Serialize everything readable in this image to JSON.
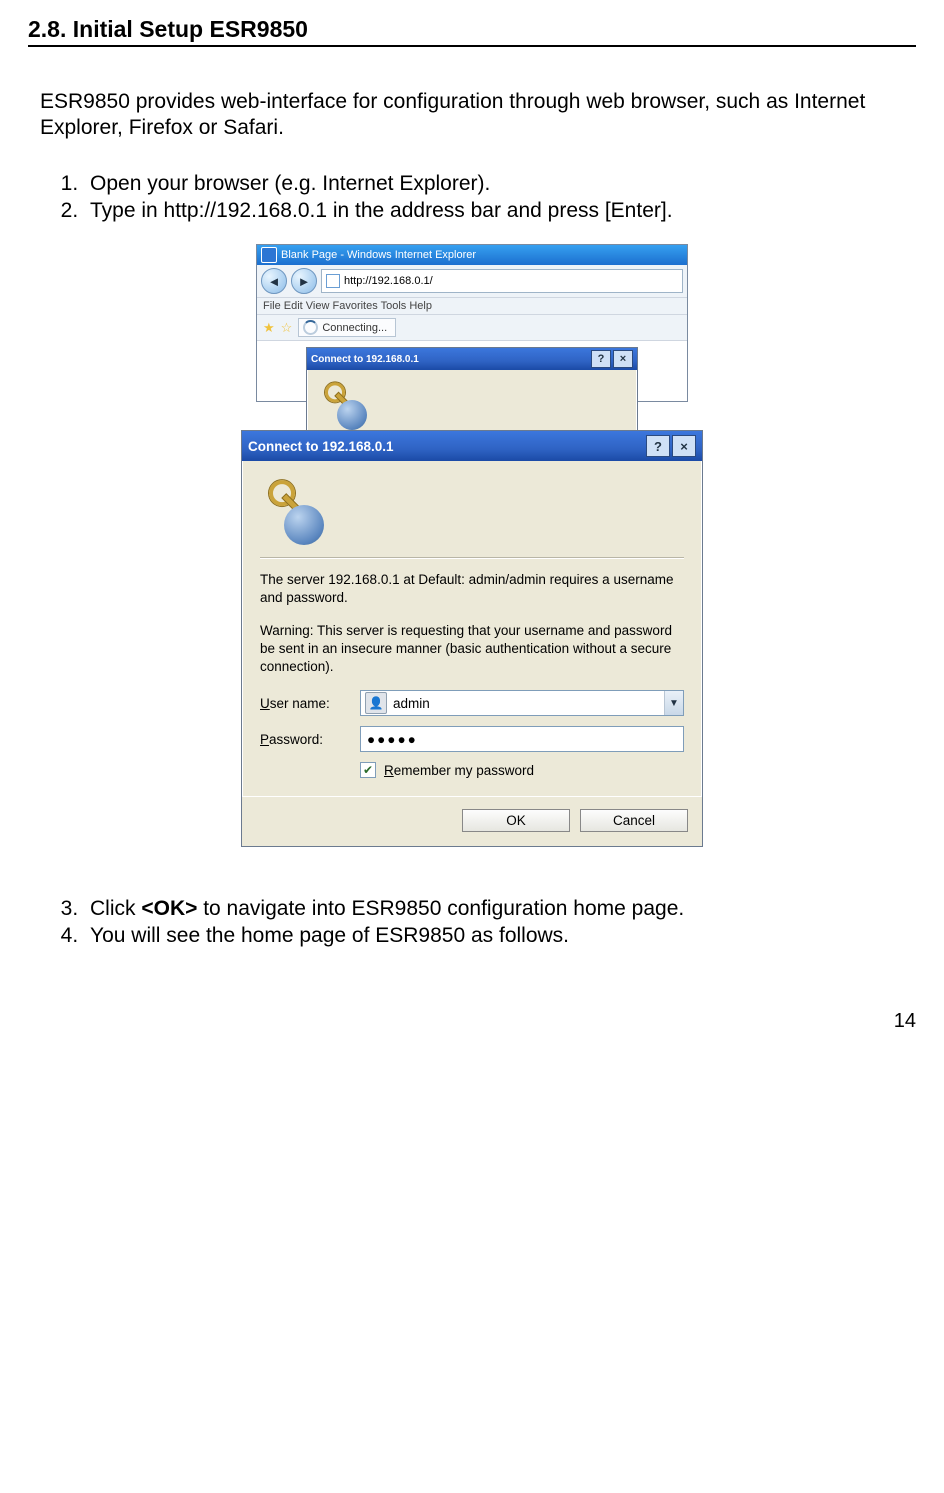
{
  "section_title": "2.8. Initial Setup ESR9850",
  "intro": "ESR9850 provides web-interface for configuration through web browser, such as Internet Explorer, Firefox or Safari.",
  "steps_a": [
    "Open your browser (e.g. Internet Explorer).",
    "Type in http://192.168.0.1 in the address bar and press [Enter]."
  ],
  "ie": {
    "title": "Blank Page - Windows Internet Explorer",
    "address": "http://192.168.0.1/",
    "menu": "File    Edit    View    Favorites    Tools    Help",
    "tab": "Connecting..."
  },
  "dialog": {
    "title": "Connect to 192.168.0.1",
    "msg1": "The server 192.168.0.1 at Default: admin/admin requires a username and password.",
    "msg2": "Warning: This server is requesting that your username and password be sent in an insecure manner (basic authentication without a secure connection).",
    "user_label_pre": "U",
    "user_label_rest": "ser name:",
    "pass_label_pre": "P",
    "pass_label_rest": "assword:",
    "remember_pre": "R",
    "remember_rest": "emember my password",
    "ok": "OK",
    "cancel": "Cancel",
    "empty_user_cursor": "|",
    "filled_user": "admin",
    "filled_pass": "●●●●●"
  },
  "steps_b": {
    "3_pre": "Click ",
    "3_bold": "<OK>",
    "3_post": " to navigate into ESR9850 configuration home page.",
    "4": "You will see the home page of ESR9850 as follows."
  },
  "page_number": "14"
}
